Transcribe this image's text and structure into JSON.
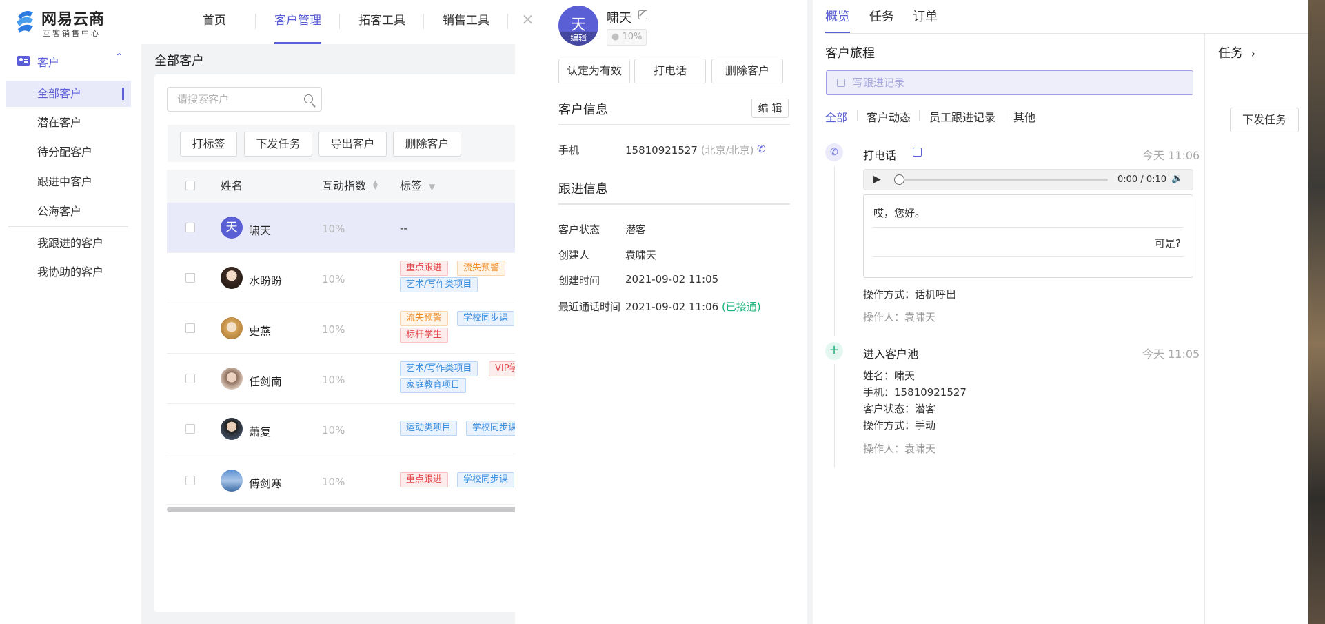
{
  "brand": {
    "name": "网易云商",
    "slogan": "互客销售中心"
  },
  "nav": {
    "tabs": [
      "首页",
      "客户管理",
      "拓客工具",
      "销售工具"
    ],
    "active": "客户管理"
  },
  "sidebar": {
    "group": "客户",
    "items": [
      "全部客户",
      "潜在客户",
      "待分配客户",
      "跟进中客户",
      "公海客户"
    ],
    "items2": [
      "我跟进的客户",
      "我协助的客户"
    ]
  },
  "main": {
    "title": "全部客户",
    "search_placeholder": "请搜索客户",
    "toolbar": [
      "打标签",
      "下发任务",
      "导出客户",
      "删除客户"
    ],
    "columns": [
      "姓名",
      "互动指数",
      "标签"
    ],
    "rows": [
      {
        "name": "啸天",
        "avatar_text": "天",
        "score": "10%",
        "tags": [
          {
            "text": "--",
            "color": "none"
          }
        ]
      },
      {
        "name": "水盼盼",
        "score": "10%",
        "tags": [
          {
            "text": "重点跟进",
            "color": "red"
          },
          {
            "text": "流失预警",
            "color": "orange"
          },
          {
            "text": "艺术/写作类项目",
            "color": "blue"
          }
        ]
      },
      {
        "name": "史燕",
        "score": "10%",
        "tags": [
          {
            "text": "流失预警",
            "color": "orange"
          },
          {
            "text": "学校同步课",
            "color": "blue"
          },
          {
            "text": "标杆学生",
            "color": "red"
          }
        ]
      },
      {
        "name": "任剑南",
        "score": "10%",
        "tags": [
          {
            "text": "艺术/写作类项目",
            "color": "blue"
          },
          {
            "text": "VIP学生",
            "color": "red"
          },
          {
            "text": "家庭教育项目",
            "color": "blue"
          }
        ]
      },
      {
        "name": "萧复",
        "score": "10%",
        "tags": [
          {
            "text": "运动类项目",
            "color": "blue"
          },
          {
            "text": "学校同步课",
            "color": "blue"
          }
        ]
      },
      {
        "name": "傅剑寒",
        "score": "10%",
        "tags": [
          {
            "text": "重点跟进",
            "color": "red"
          },
          {
            "text": "学校同步课",
            "color": "blue"
          }
        ]
      }
    ]
  },
  "detail": {
    "close": "×",
    "avatar_char": "天",
    "avatar_edit": "编辑",
    "name": "啸天",
    "score": "10%",
    "actions": [
      "认定为有效",
      "打电话",
      "删除客户"
    ],
    "info_title": "客户信息",
    "edit_label": "编 辑",
    "phone_label": "手机",
    "phone": "15810921527",
    "phone_region": "(北京/北京)",
    "follow_title": "跟进信息",
    "fields": [
      {
        "label": "客户状态",
        "value": "潜客"
      },
      {
        "label": "创建人",
        "value": "袁啸天"
      },
      {
        "label": "创建时间",
        "value": "2021-09-02 11:05"
      },
      {
        "label": "最近通话时间",
        "value": "2021-09-02 11:06"
      }
    ],
    "call_status": "(已接通)"
  },
  "overview": {
    "tabs": [
      "概览",
      "任务",
      "订单"
    ],
    "journey_title": "客户旅程",
    "write_placeholder": "写跟进记录",
    "filters": [
      "全部",
      "客户动态",
      "员工跟进记录",
      "其他"
    ],
    "event1": {
      "title": "打电话",
      "time": "今天 11:06",
      "audio_time": "0:00 / 0:10",
      "line1": "哎，您好。",
      "line2": "可是?",
      "method": "操作方式：话机呼出",
      "operator": "操作人：袁啸天"
    },
    "event2": {
      "title": "进入客户池",
      "time": "今天 11:05",
      "lines": [
        "姓名：啸天",
        "手机：15810921527",
        "客户状态：潜客",
        "操作方式：手动"
      ],
      "operator": "操作人：袁啸天"
    },
    "task_title": "任务",
    "task_button": "下发任务"
  },
  "colors": {
    "accent": "#5b5fd6",
    "selected_row": "#e9eaf9",
    "green": "#19b37a"
  }
}
